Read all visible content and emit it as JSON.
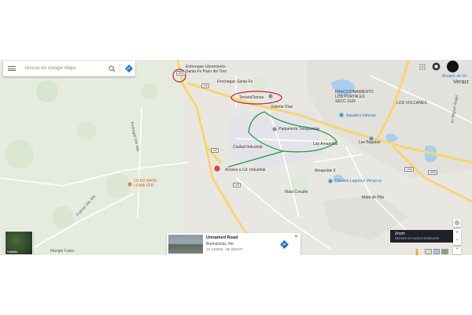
{
  "search": {
    "placeholder": "Buscar en Google Maps"
  },
  "labels": {
    "entronque1": "Entronque Libramiento",
    "entronque2": "Santa Fe Paso del Toro",
    "ferchegas": "Ferchegas Santa Fe",
    "tenaria": "TenariaTamsa",
    "valente": "Valente Díaz",
    "paqueteria": "Paquetería Trespuertas",
    "ciudad_industrial": "Ciudad Industrial",
    "amapolas": "Las Amapolas",
    "bajadas": "Las Bajadas",
    "acceso": "Acceso a Cd. Industrial",
    "amapolas2": "Amapolas II",
    "mata_cocuite": "Mata Cocuite",
    "dreams": "Dreams Lagoons Veracruz",
    "mata_pita": "Mata de Pita",
    "oxxo1": "OXXO MATA",
    "oxxo2": "LOMA VER",
    "fraccionamiento1": "FRACCIONAMIENTO",
    "fraccionamiento2": "LOS PORTALES",
    "fraccionamiento3": "SECC SUR",
    "volcanes": "LOS VOLCANES",
    "aquatico": "Aquatico Inbursa",
    "acuario": "Acuario de Ve",
    "veracruz": "Veracr",
    "mango": "Manglo Fabio",
    "pedregal": "Pedregal Ote Wa",
    "fuente": "Fuente Ote Wa",
    "magallanes": "Av Miguel Ángel"
  },
  "shields": [
    "180D",
    "140",
    "140",
    "140",
    "180D",
    "140D"
  ],
  "card": {
    "title": "Unnamed Road",
    "place": "Buenavista, Ver.",
    "coords": "19.140606, -96.256407"
  },
  "satellite_label": "Satélite",
  "zoom": {
    "title": "Zoom",
    "hint": "Mostrar el control deslizante"
  },
  "controls": {
    "plus": "+",
    "minus": "−"
  },
  "colors": {
    "highway": "#f7d66e",
    "road": "#ffffff",
    "green_annotation": "#17a23a",
    "red_annotation": "#c8202a",
    "water": "#a9cfee"
  }
}
